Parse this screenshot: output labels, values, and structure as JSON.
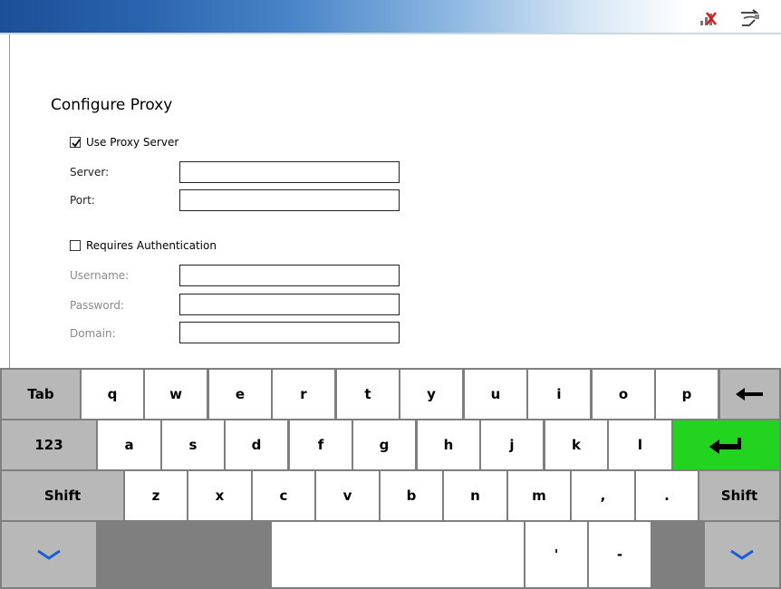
{
  "titlebar": {
    "icons": [
      "network-disconnected-icon",
      "proxy-connection-icon"
    ]
  },
  "page": {
    "title": "Configure Proxy"
  },
  "proxy": {
    "use_proxy_label": "Use Proxy Server",
    "use_proxy_checked": true,
    "server_label": "Server:",
    "server_value": "",
    "port_label": "Port:",
    "port_value": ""
  },
  "auth": {
    "requires_auth_label": "Requires Authentication",
    "requires_auth_checked": false,
    "username_label": "Username:",
    "username_value": "",
    "password_label": "Password:",
    "password_value": "",
    "domain_label": "Domain:",
    "domain_value": ""
  },
  "keyboard": {
    "row1": {
      "tab": "Tab",
      "letters": [
        "q",
        "w",
        "e",
        "r",
        "t",
        "y",
        "u",
        "i",
        "o",
        "p"
      ],
      "backspace_icon": "backspace-arrow-icon"
    },
    "row2": {
      "numbers": "123",
      "letters": [
        "a",
        "s",
        "d",
        "f",
        "g",
        "h",
        "j",
        "k",
        "l"
      ],
      "enter_icon": "enter-arrow-icon"
    },
    "row3": {
      "shift_left": "Shift",
      "letters": [
        "z",
        "x",
        "c",
        "v",
        "b",
        "n",
        "m",
        ",",
        "."
      ],
      "shift_right": "Shift"
    },
    "row4": {
      "hide_left_icon": "chevron-down-icon",
      "space": "",
      "apostrophe": "'",
      "dash": "-",
      "hide_right_icon": "chevron-down-icon"
    }
  },
  "colors": {
    "enter_key": "#22d41f",
    "keyboard_bg": "#7f7f7f",
    "modifier_key": "#b8b8b8",
    "chevron": "#1a5fd6"
  }
}
